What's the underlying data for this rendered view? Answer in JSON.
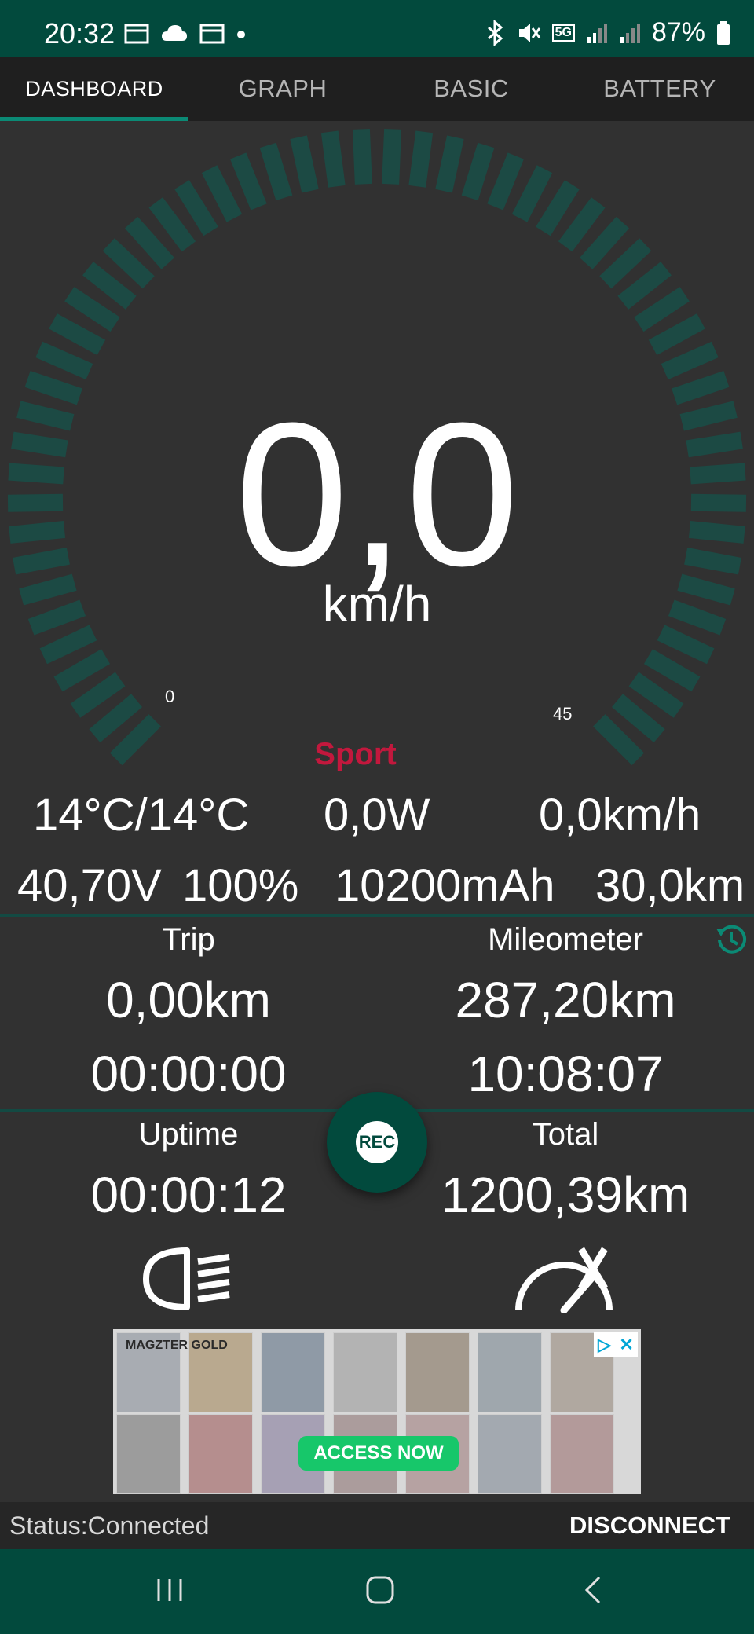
{
  "status_bar": {
    "time": "20:32",
    "battery": "87%",
    "network": "5G"
  },
  "tabs": [
    {
      "label": "DASHBOARD",
      "active": true
    },
    {
      "label": "GRAPH",
      "active": false
    },
    {
      "label": "BASIC",
      "active": false
    },
    {
      "label": "BATTERY",
      "active": false
    }
  ],
  "gauge": {
    "speed": "0,0",
    "unit": "km/h",
    "scale_min": "0",
    "scale_max": "45",
    "mode": "Sport"
  },
  "metrics": {
    "temperature": "14°C/14°C",
    "power": "0,0W",
    "avg_speed": "0,0km/h",
    "voltage": "40,70V",
    "battery_percent": "100%",
    "capacity": "10200mAh",
    "range": "30,0km"
  },
  "trip": {
    "trip_label": "Trip",
    "trip_distance": "0,00km",
    "trip_time": "00:00:00",
    "mileometer_label": "Mileometer",
    "mileometer_distance": "287,20km",
    "mileometer_time": "10:08:07",
    "uptime_label": "Uptime",
    "uptime_value": "00:00:12",
    "total_label": "Total",
    "total_value": "1200,39km",
    "rec_label": "REC"
  },
  "ad": {
    "brand": "MAGZTER GOLD",
    "cta": "ACCESS NOW"
  },
  "footer": {
    "status": "Status:Connected",
    "disconnect": "DISCONNECT"
  },
  "colors": {
    "accent": "#024a3d",
    "tab_indicator": "#0b8a75",
    "mode_text": "#c2183d",
    "background": "#313131"
  }
}
